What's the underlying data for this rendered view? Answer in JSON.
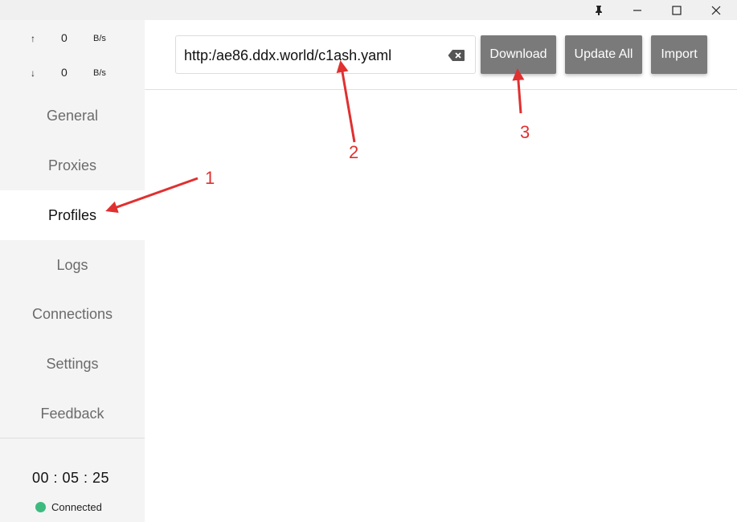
{
  "window": {
    "pin_icon": "pin-icon",
    "minimize_icon": "minimize-icon",
    "maximize_icon": "maximize-icon",
    "close_icon": "close-icon"
  },
  "traffic": {
    "up_arrow": "↑",
    "up_value": "0",
    "up_unit": "B/s",
    "down_arrow": "↓",
    "down_value": "0",
    "down_unit": "B/s"
  },
  "sidebar": {
    "items": [
      {
        "label": "General"
      },
      {
        "label": "Proxies"
      },
      {
        "label": "Profiles"
      },
      {
        "label": "Logs"
      },
      {
        "label": "Connections"
      },
      {
        "label": "Settings"
      },
      {
        "label": "Feedback"
      }
    ],
    "active": "Profiles",
    "timer": "00 : 05 : 25",
    "status": "Connected",
    "status_color": "#3dbb7f"
  },
  "profiles": {
    "url_value": "http:/ae86.ddx.world/c1ash.yaml",
    "clear_icon": "backspace-clear-icon",
    "download_label": "Download",
    "update_all_label": "Update All",
    "import_label": "Import"
  },
  "annotations": {
    "one": "1",
    "two": "2",
    "three": "3",
    "color": "#e03030"
  }
}
